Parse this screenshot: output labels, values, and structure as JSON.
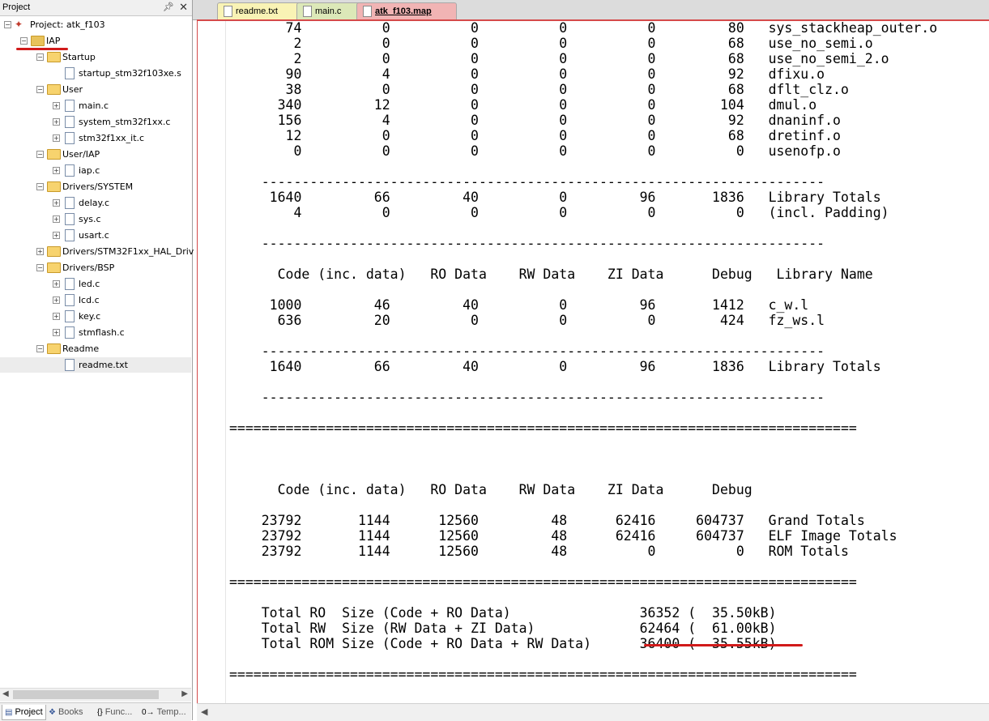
{
  "project_pane": {
    "title": "Project",
    "pin_icon": "pushpin-icon",
    "close_icon": "close-icon",
    "tree": [
      {
        "label": "Project: atk_f103",
        "indent": 0,
        "kind": "project",
        "expander": "minus"
      },
      {
        "label": "IAP",
        "indent": 1,
        "kind": "target",
        "expander": "minus"
      },
      {
        "label": "Startup",
        "indent": 2,
        "kind": "folder",
        "expander": "minus"
      },
      {
        "label": "startup_stm32f103xe.s",
        "indent": 3,
        "kind": "file",
        "expander": "none"
      },
      {
        "label": "User",
        "indent": 2,
        "kind": "folder",
        "expander": "minus"
      },
      {
        "label": "main.c",
        "indent": 3,
        "kind": "file",
        "expander": "plus"
      },
      {
        "label": "system_stm32f1xx.c",
        "indent": 3,
        "kind": "file",
        "expander": "plus"
      },
      {
        "label": "stm32f1xx_it.c",
        "indent": 3,
        "kind": "file",
        "expander": "plus"
      },
      {
        "label": "User/IAP",
        "indent": 2,
        "kind": "folder",
        "expander": "minus"
      },
      {
        "label": "iap.c",
        "indent": 3,
        "kind": "file",
        "expander": "plus"
      },
      {
        "label": "Drivers/SYSTEM",
        "indent": 2,
        "kind": "folder",
        "expander": "minus"
      },
      {
        "label": "delay.c",
        "indent": 3,
        "kind": "file",
        "expander": "plus"
      },
      {
        "label": "sys.c",
        "indent": 3,
        "kind": "file",
        "expander": "plus"
      },
      {
        "label": "usart.c",
        "indent": 3,
        "kind": "file",
        "expander": "plus"
      },
      {
        "label": "Drivers/STM32F1xx_HAL_Driv",
        "indent": 2,
        "kind": "folder",
        "expander": "plus"
      },
      {
        "label": "Drivers/BSP",
        "indent": 2,
        "kind": "folder",
        "expander": "minus"
      },
      {
        "label": "led.c",
        "indent": 3,
        "kind": "file",
        "expander": "plus"
      },
      {
        "label": "lcd.c",
        "indent": 3,
        "kind": "file",
        "expander": "plus"
      },
      {
        "label": "key.c",
        "indent": 3,
        "kind": "file",
        "expander": "plus"
      },
      {
        "label": "stmflash.c",
        "indent": 3,
        "kind": "file",
        "expander": "plus"
      },
      {
        "label": "Readme",
        "indent": 2,
        "kind": "folder",
        "expander": "minus"
      },
      {
        "label": "readme.txt",
        "indent": 3,
        "kind": "file",
        "expander": "none",
        "selected": true
      }
    ],
    "bottom_tabs": [
      {
        "label": "Project",
        "icon": "project-icon",
        "active": true
      },
      {
        "label": "Books",
        "icon": "books-icon",
        "active": false
      },
      {
        "label": "Func...",
        "icon": "functions-icon",
        "active": false
      },
      {
        "label": "Temp...",
        "icon": "templates-icon",
        "active": false
      }
    ]
  },
  "editor_tabs": [
    {
      "label": "readme.txt",
      "icon": "file-icon",
      "active": false
    },
    {
      "label": "main.c",
      "icon": "file-icon",
      "active": false
    },
    {
      "label": "atk_f103.map",
      "icon": "file-icon",
      "active": true
    }
  ],
  "editor": {
    "lines": [
      "       74          0          0          0          0         80   sys_stackheap_outer.o",
      "        2          0          0          0          0         68   use_no_semi.o",
      "        2          0          0          0          0         68   use_no_semi_2.o",
      "       90          4          0          0          0         92   dfixu.o",
      "       38          0          0          0          0         68   dflt_clz.o",
      "      340         12          0          0          0        104   dmul.o",
      "      156          4          0          0          0         92   dnaninf.o",
      "       12          0          0          0          0         68   dretinf.o",
      "        0          0          0          0          0          0   usenofp.o",
      "",
      "    ----------------------------------------------------------------------",
      "     1640         66         40          0         96       1836   Library Totals",
      "        4          0          0          0          0          0   (incl. Padding)",
      "",
      "    ----------------------------------------------------------------------",
      "",
      "      Code (inc. data)   RO Data    RW Data    ZI Data      Debug   Library Name",
      "",
      "     1000         46         40          0         96       1412   c_w.l",
      "      636         20          0          0          0        424   fz_ws.l",
      "",
      "    ----------------------------------------------------------------------",
      "     1640         66         40          0         96       1836   Library Totals",
      "",
      "    ----------------------------------------------------------------------",
      "",
      "==============================================================================",
      "",
      "",
      "",
      "      Code (inc. data)   RO Data    RW Data    ZI Data      Debug",
      "",
      "    23792       1144      12560         48      62416     604737   Grand Totals",
      "    23792       1144      12560         48      62416     604737   ELF Image Totals",
      "    23792       1144      12560         48          0          0   ROM Totals",
      "",
      "==============================================================================",
      "",
      "    Total RO  Size (Code + RO Data)                36352 (  35.50kB)",
      "    Total RW  Size (RW Data + ZI Data)             62464 (  61.00kB)",
      "    Total ROM Size (Code + RO Data + RW Data)      36400 (  35.55kB)",
      "",
      "=============================================================================="
    ]
  },
  "highlight_color": "#d11a1a",
  "active_tab_color": "#f1b4b4"
}
